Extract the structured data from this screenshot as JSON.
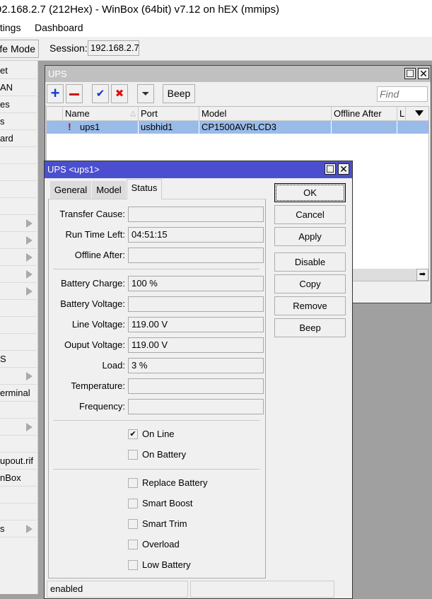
{
  "app": {
    "title": "92.168.2.7 (212Hex) - WinBox (64bit) v7.12 on hEX (mmips)",
    "menu": [
      "ttings",
      "Dashboard"
    ],
    "safe_mode_label": "fe Mode",
    "session_label": "Session:",
    "session_value": "192.168.2.7"
  },
  "sidebar": {
    "items": [
      {
        "label": "et",
        "submenu": false
      },
      {
        "label": "AN",
        "submenu": false
      },
      {
        "label": "es",
        "submenu": false
      },
      {
        "label": "s",
        "submenu": false
      },
      {
        "label": "ard",
        "submenu": false
      },
      {
        "label": "",
        "submenu": false
      },
      {
        "label": "",
        "submenu": false
      },
      {
        "label": "",
        "submenu": false
      },
      {
        "label": "",
        "submenu": false
      },
      {
        "label": "",
        "submenu": true
      },
      {
        "label": "",
        "submenu": true
      },
      {
        "label": "",
        "submenu": true
      },
      {
        "label": "",
        "submenu": true
      },
      {
        "label": "",
        "submenu": true
      },
      {
        "label": "",
        "submenu": false
      },
      {
        "label": "",
        "submenu": false
      },
      {
        "label": "",
        "submenu": false
      },
      {
        "label": "S",
        "submenu": false
      },
      {
        "label": "",
        "submenu": true
      },
      {
        "label": "erminal",
        "submenu": false
      },
      {
        "label": "",
        "submenu": false
      },
      {
        "label": "",
        "submenu": true
      },
      {
        "label": "",
        "submenu": false
      },
      {
        "label": "upout.rif",
        "submenu": false
      },
      {
        "label": "nBox",
        "submenu": false
      },
      {
        "label": "",
        "submenu": false
      },
      {
        "label": "",
        "submenu": false
      },
      {
        "label": "s",
        "submenu": true
      }
    ]
  },
  "ups_window": {
    "title": "UPS",
    "beep_label": "Beep",
    "find_placeholder": "Find",
    "columns": [
      "Name",
      "Port",
      "Model",
      "Offline After",
      "L"
    ],
    "rows": [
      {
        "name": "ups1",
        "port": "usbhid1",
        "model": "CP1500AVRLCD3",
        "offline_after": ""
      }
    ]
  },
  "dialog": {
    "title": "UPS <ups1>",
    "tabs": [
      "General",
      "Model",
      "Status"
    ],
    "active_tab": "Status",
    "buttons": {
      "ok": "OK",
      "cancel": "Cancel",
      "apply": "Apply",
      "disable": "Disable",
      "copy": "Copy",
      "remove": "Remove",
      "beep": "Beep"
    },
    "fields": [
      {
        "label": "Transfer Cause:",
        "value": ""
      },
      {
        "label": "Run Time Left:",
        "value": "04:51:15"
      },
      {
        "label": "Offline After:",
        "value": ""
      },
      {
        "label": "Battery Charge:",
        "value": "100 %"
      },
      {
        "label": "Battery Voltage:",
        "value": ""
      },
      {
        "label": "Line Voltage:",
        "value": "119.00 V"
      },
      {
        "label": "Ouput Voltage:",
        "value": "119.00 V"
      },
      {
        "label": "Load:",
        "value": "3 %"
      },
      {
        "label": "Temperature:",
        "value": ""
      },
      {
        "label": "Frequency:",
        "value": ""
      }
    ],
    "checkboxes": [
      {
        "label": "On Line",
        "checked": true
      },
      {
        "label": "On Battery",
        "checked": false
      },
      {
        "label": "Replace Battery",
        "checked": false
      },
      {
        "label": "Smart Boost",
        "checked": false
      },
      {
        "label": "Smart Trim",
        "checked": false
      },
      {
        "label": "Overload",
        "checked": false
      },
      {
        "label": "Low Battery",
        "checked": false
      }
    ],
    "status": "enabled"
  }
}
